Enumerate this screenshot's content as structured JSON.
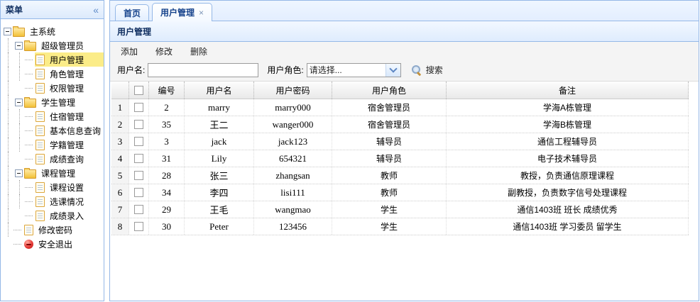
{
  "colors": {
    "panel_border": "#95B8E7",
    "selected_item_bg": "#FBEC88",
    "panel_title_text": "#0E2D5F",
    "gray_toolbar_bg": "#F4F4F4"
  },
  "sidebar": {
    "title": "菜单",
    "collapse_icon": "«",
    "tree": [
      {
        "label": "主系统",
        "level": 0,
        "type": "folder",
        "selected": false
      },
      {
        "label": "超级管理员",
        "level": 1,
        "type": "folder",
        "selected": false
      },
      {
        "label": "用户管理",
        "level": 2,
        "type": "doc",
        "selected": true
      },
      {
        "label": "角色管理",
        "level": 2,
        "type": "doc",
        "selected": false
      },
      {
        "label": "权限管理",
        "level": 2,
        "type": "doc",
        "selected": false
      },
      {
        "label": "学生管理",
        "level": 1,
        "type": "folder",
        "selected": false
      },
      {
        "label": "住宿管理",
        "level": 2,
        "type": "doc",
        "selected": false
      },
      {
        "label": "基本信息查询",
        "level": 2,
        "type": "doc",
        "selected": false
      },
      {
        "label": "学籍管理",
        "level": 2,
        "type": "doc",
        "selected": false
      },
      {
        "label": "成绩查询",
        "level": 2,
        "type": "doc",
        "selected": false
      },
      {
        "label": "课程管理",
        "level": 1,
        "type": "folder",
        "selected": false
      },
      {
        "label": "课程设置",
        "level": 2,
        "type": "doc",
        "selected": false
      },
      {
        "label": "选课情况",
        "level": 2,
        "type": "doc",
        "selected": false
      },
      {
        "label": "成绩录入",
        "level": 2,
        "type": "doc",
        "selected": false
      },
      {
        "label": "修改密码",
        "level": 1,
        "type": "doc",
        "selected": false
      },
      {
        "label": "安全退出",
        "level": 1,
        "type": "exit",
        "selected": false
      }
    ]
  },
  "tabs": [
    {
      "label": "首页",
      "active": false,
      "closable": false
    },
    {
      "label": "用户管理",
      "active": true,
      "closable": true,
      "close_icon": "×"
    }
  ],
  "panel": {
    "title": "用户管理"
  },
  "toolbar": {
    "add_label": "添加",
    "edit_label": "修改",
    "delete_label": "删除"
  },
  "search": {
    "username_label": "用户名:",
    "username_value": "",
    "role_label": "用户角色:",
    "role_selected": "请选择...",
    "search_label": "搜索"
  },
  "grid": {
    "columns": [
      "编号",
      "用户名",
      "用户密码",
      "用户角色",
      "备注"
    ],
    "rows": [
      {
        "num": "1",
        "id": "2",
        "username": "marry",
        "password": "marry000",
        "role": "宿舍管理员",
        "remark": "学海A栋管理"
      },
      {
        "num": "2",
        "id": "35",
        "username": "王二",
        "password": "wanger000",
        "role": "宿舍管理员",
        "remark": "学海B栋管理"
      },
      {
        "num": "3",
        "id": "3",
        "username": "jack",
        "password": "jack123",
        "role": "辅导员",
        "remark": "通信工程辅导员"
      },
      {
        "num": "4",
        "id": "31",
        "username": "Lily",
        "password": "654321",
        "role": "辅导员",
        "remark": "电子技术辅导员"
      },
      {
        "num": "5",
        "id": "28",
        "username": "张三",
        "password": "zhangsan",
        "role": "教师",
        "remark": "教授，负责通信原理课程"
      },
      {
        "num": "6",
        "id": "34",
        "username": "李四",
        "password": "lisi111",
        "role": "教师",
        "remark": "副教授，负责数字信号处理课程"
      },
      {
        "num": "7",
        "id": "29",
        "username": "王毛",
        "password": "wangmao",
        "role": "学生",
        "remark": "通信1403班 班长 成绩优秀"
      },
      {
        "num": "8",
        "id": "30",
        "username": "Peter",
        "password": "123456",
        "role": "学生",
        "remark": "通信1403班 学习委员 留学生"
      }
    ]
  }
}
